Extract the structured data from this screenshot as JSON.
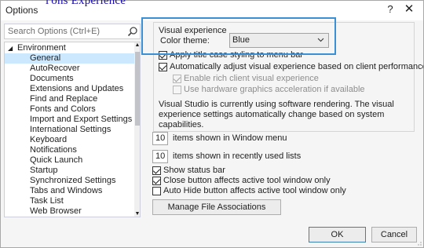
{
  "dialog": {
    "title": "Options",
    "help_label": "?",
    "close_label": "✕"
  },
  "top_partial_text": "l'ons Experience",
  "search": {
    "placeholder": "Search Options (Ctrl+E)",
    "icon": "search-icon"
  },
  "tree": {
    "root": {
      "label": "Environment",
      "expanded": true
    },
    "children": [
      {
        "label": "General",
        "selected": true
      },
      {
        "label": "AutoRecover"
      },
      {
        "label": "Documents"
      },
      {
        "label": "Extensions and Updates"
      },
      {
        "label": "Find and Replace"
      },
      {
        "label": "Fonts and Colors"
      },
      {
        "label": "Import and Export Settings"
      },
      {
        "label": "International Settings"
      },
      {
        "label": "Keyboard"
      },
      {
        "label": "Notifications"
      },
      {
        "label": "Quick Launch"
      },
      {
        "label": "Startup"
      },
      {
        "label": "Synchronized Settings"
      },
      {
        "label": "Tabs and Windows"
      },
      {
        "label": "Task List"
      },
      {
        "label": "Web Browser"
      }
    ]
  },
  "visual_experience": {
    "legend": "Visual experience",
    "color_theme_label": "Color theme:",
    "color_theme_value": "Blue",
    "apply_title_case": "Apply title case styling to menu bar",
    "auto_adjust": "Automatically adjust visual experience based on client performance",
    "enable_rich": "Enable rich client visual experience",
    "use_hw_accel": "Use hardware graphics acceleration if available",
    "info": "Visual Studio is currently using software rendering.  The visual experience settings automatically change based on system capabilities."
  },
  "window_menu": {
    "value": "10",
    "label": "items shown in Window menu"
  },
  "recent_lists": {
    "value": "10",
    "label": "items shown in recently used lists"
  },
  "show_status_bar": "Show status bar",
  "close_button_affects": "Close button affects active tool window only",
  "auto_hide_affects": "Auto Hide button affects active tool window only",
  "manage_file_associations": "Manage File Associations",
  "ok_label": "OK",
  "cancel_label": "Cancel",
  "colors": {
    "highlight": "#3b8fd4",
    "selection": "#cce8ff"
  }
}
